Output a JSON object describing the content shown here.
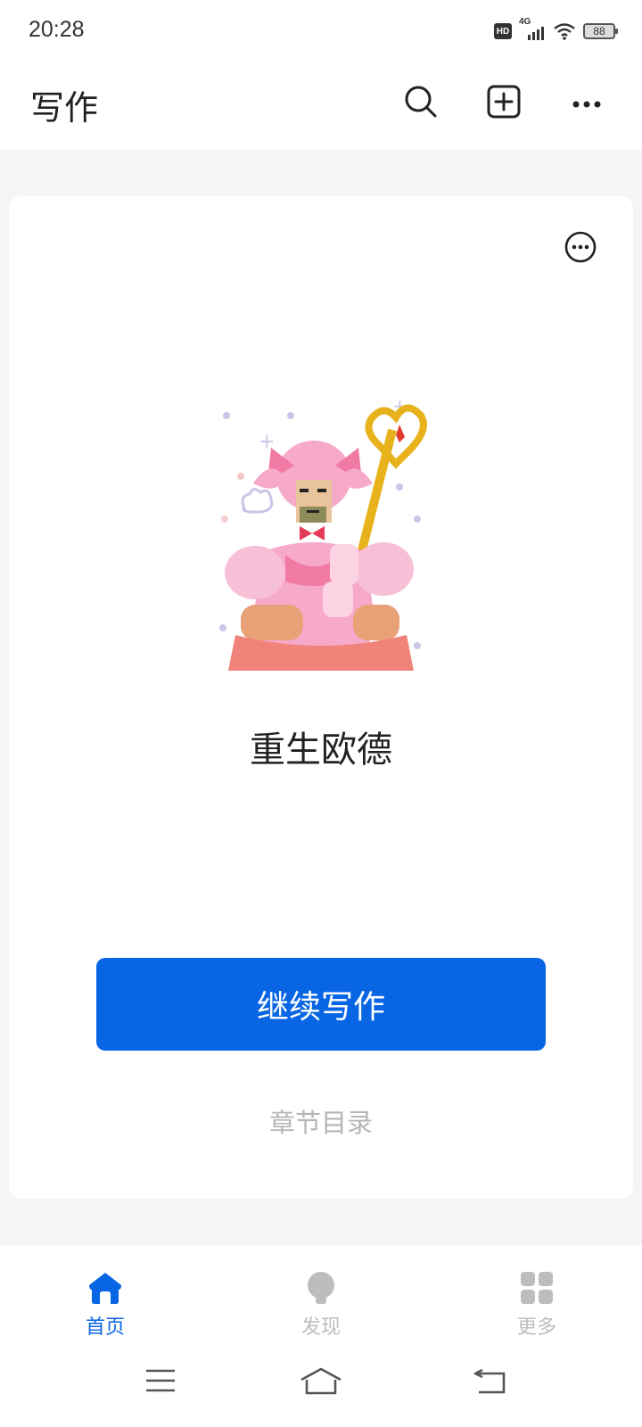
{
  "status_bar": {
    "time": "20:28",
    "hd_label": "HD",
    "network_label": "4G",
    "battery_level": "88"
  },
  "header": {
    "title": "写作",
    "icons": [
      "search-icon",
      "add-square-icon",
      "more-horizontal-icon"
    ]
  },
  "book": {
    "title": "重生欧德",
    "cover_icon": "pixel-art-character-cover",
    "continue_label": "继续写作",
    "toc_label": "章节目录"
  },
  "bottom_nav": {
    "items": [
      {
        "label": "首页",
        "icon": "home-icon",
        "active": true
      },
      {
        "label": "发现",
        "icon": "bulb-icon",
        "active": false
      },
      {
        "label": "更多",
        "icon": "grid-icon",
        "active": false
      }
    ]
  },
  "colors": {
    "accent": "#0866e4",
    "inactive": "#bdbdbd",
    "background": "#f5f5f5"
  }
}
